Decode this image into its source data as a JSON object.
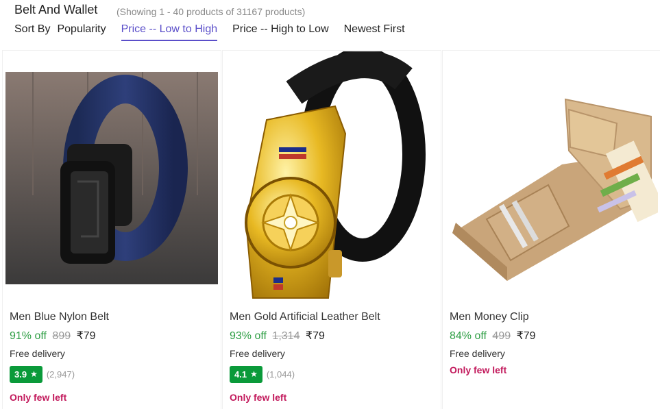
{
  "header": {
    "title": "Belt And Wallet",
    "count_text": "(Showing 1 - 40 products of 31167 products)"
  },
  "sort": {
    "label": "Sort By",
    "options": [
      {
        "label": "Popularity",
        "active": false
      },
      {
        "label": "Price -- Low to High",
        "active": true
      },
      {
        "label": "Price -- High to Low",
        "active": false
      },
      {
        "label": "Newest First",
        "active": false
      }
    ]
  },
  "colors": {
    "accent": "#5a4ec9",
    "discount": "#2e9e44",
    "rating_bg": "#0a9a3a",
    "few_left": "#c2185b"
  },
  "products": [
    {
      "name": "Men Blue Nylon Belt",
      "discount": "91% off",
      "mrp": "899",
      "price": "₹79",
      "delivery": "Free delivery",
      "rating": "3.9",
      "reviews": "(2,947)",
      "stock": "Only few left",
      "image": "blue-nylon-belt"
    },
    {
      "name": "Men Gold Artificial Leather Belt",
      "discount": "93% off",
      "mrp": "1,314",
      "price": "₹79",
      "delivery": "Free delivery",
      "rating": "4.1",
      "reviews": "(1,044)",
      "stock": "Only few left",
      "image": "gold-buckle-belt"
    },
    {
      "name": "Men Money Clip",
      "discount": "84% off",
      "mrp": "499",
      "price": "₹79",
      "delivery": "Free delivery",
      "stock": "Only few left",
      "image": "tan-money-clip-wallet"
    }
  ]
}
